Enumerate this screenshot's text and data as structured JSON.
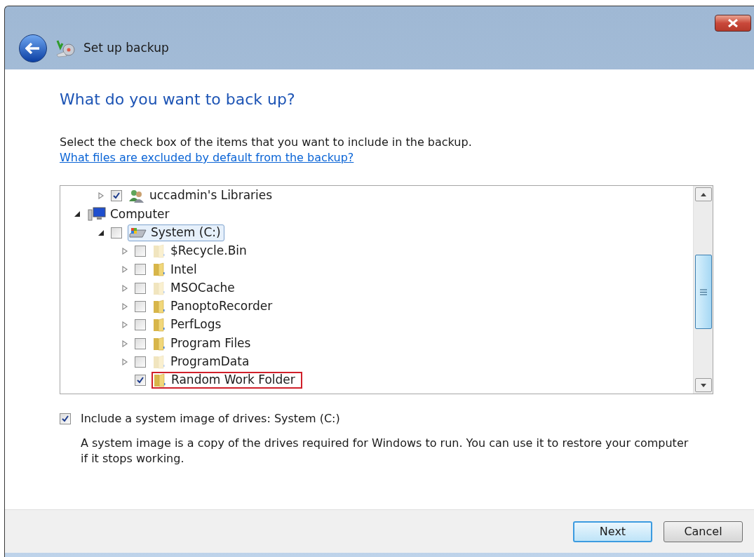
{
  "window": {
    "title": "Set up backup"
  },
  "heading": "What do you want to back up?",
  "instructions": {
    "text": "Select the check box of the items that you want to include in the backup.",
    "link": "What files are excluded by default from the backup?"
  },
  "tree": [
    {
      "label": "uccadmin's Libraries",
      "kind": "libraries",
      "expanded": false,
      "checked": true,
      "selected": false
    },
    {
      "label": "Computer",
      "kind": "computer",
      "expanded": true,
      "selected": false,
      "children": [
        {
          "label": "System (C:)",
          "kind": "drive",
          "expanded": true,
          "checked": false,
          "selected": true,
          "children": [
            {
              "label": "$Recycle.Bin",
              "kind": "folder",
              "expanded": false,
              "checked": false,
              "selected": false,
              "hidden": true,
              "highlighted": false
            },
            {
              "label": "Intel",
              "kind": "folder",
              "expanded": false,
              "checked": false,
              "selected": false,
              "hidden": false,
              "highlighted": false
            },
            {
              "label": "MSOCache",
              "kind": "folder",
              "expanded": false,
              "checked": false,
              "selected": false,
              "hidden": true,
              "highlighted": false
            },
            {
              "label": "PanoptoRecorder",
              "kind": "folder",
              "expanded": false,
              "checked": false,
              "selected": false,
              "hidden": false,
              "highlighted": false
            },
            {
              "label": "PerfLogs",
              "kind": "folder",
              "expanded": false,
              "checked": false,
              "selected": false,
              "hidden": false,
              "highlighted": false
            },
            {
              "label": "Program Files",
              "kind": "folder",
              "expanded": false,
              "checked": false,
              "selected": false,
              "hidden": false,
              "highlighted": false
            },
            {
              "label": "ProgramData",
              "kind": "folder",
              "expanded": false,
              "checked": false,
              "selected": false,
              "hidden": true,
              "highlighted": false
            },
            {
              "label": "Random Work Folder",
              "kind": "folder",
              "checked": true,
              "selected": false,
              "hidden": false,
              "highlighted": true
            }
          ]
        }
      ]
    }
  ],
  "system_image": {
    "label": "Include a system image of drives: System (C:)",
    "checked": true,
    "description": "A system image is a copy of the drives required for Windows to run. You can use it to restore your computer if it stops working."
  },
  "buttons": [
    {
      "label": "Next",
      "default": true
    },
    {
      "label": "Cancel",
      "default": false
    }
  ]
}
